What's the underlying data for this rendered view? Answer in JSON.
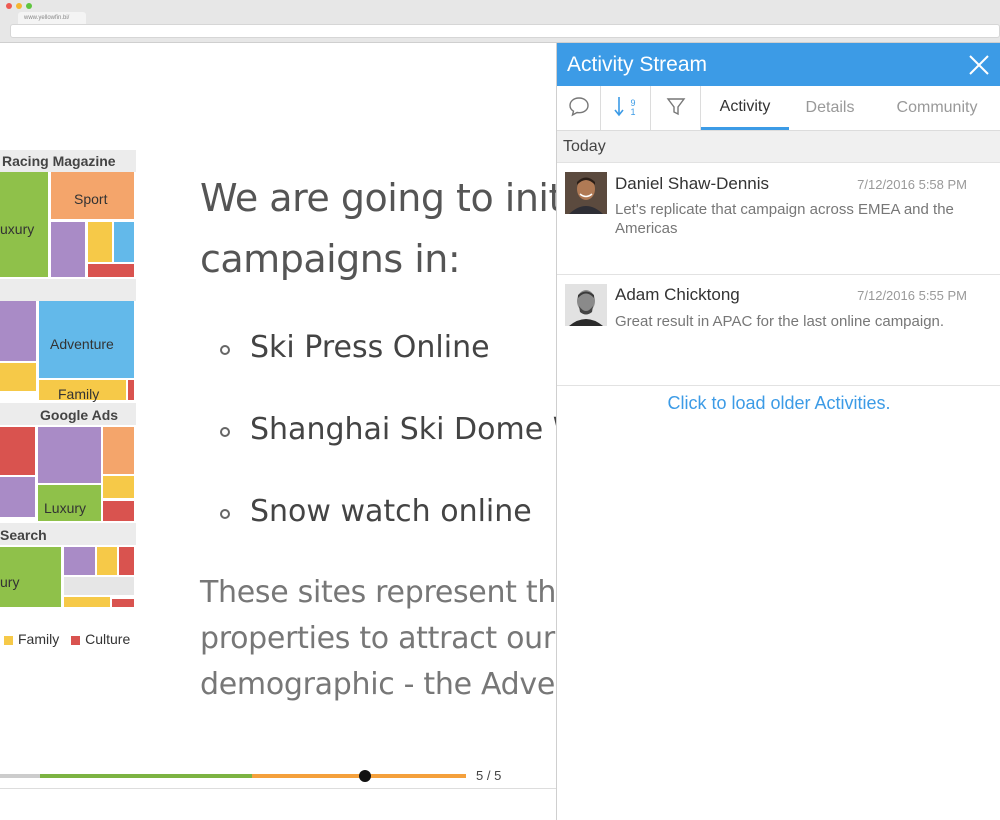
{
  "browser": {
    "url": "www.yellowfin.bi/",
    "traffic_lights": [
      "#ee5a52",
      "#f5b631",
      "#5fc53f"
    ]
  },
  "treemap": {
    "sections": {
      "racing_magazine": "Racing Magazine",
      "google_ads": "Google Ads",
      "search": "Search"
    },
    "labels": {
      "luxury_1": "uxury",
      "sport": "Sport",
      "adventure": "Adventure",
      "family": "Family",
      "luxury_2": "Luxury",
      "luxury_3": "ury"
    },
    "legend": [
      {
        "label": "Family",
        "color": "#f6c948"
      },
      {
        "label": "Culture",
        "color": "#d9534f"
      }
    ],
    "colors": {
      "green": "#8fc14a",
      "orange": "#f4a56b",
      "purple": "#a98bc6",
      "blue": "#63b9ea",
      "yellow": "#f6c948",
      "red": "#d9534f"
    }
  },
  "slide": {
    "heading_line1": "We are going to initi",
    "heading_line2": "campaigns in:",
    "bullets": [
      "Ski Press Online",
      "Shanghai Ski Dome W",
      "Snow watch online"
    ],
    "para_line1": "These sites represent the b",
    "para_line2": "properties to attract our h",
    "para_line3": "demographic - the Advent",
    "page_indicator": "5 / 5",
    "progress_colors": [
      "#cccccc",
      "#7cb342",
      "#f4a03c"
    ]
  },
  "activity_panel": {
    "title": "Activity Stream",
    "tabs": [
      "Activity",
      "Details",
      "Community"
    ],
    "active_tab": "Activity",
    "sort_badge": "9 1",
    "section_label": "Today",
    "accent": "#3c9be6",
    "items": [
      {
        "name": "Daniel Shaw-Dennis",
        "time": "7/12/2016 5:58 PM",
        "message": "Let's replicate that campaign across EMEA and the Americas"
      },
      {
        "name": "Adam Chicktong",
        "time": "7/12/2016 5:55 PM",
        "message": "Great result in APAC for the last online campaign."
      }
    ],
    "load_more": "Click to load older Activities."
  }
}
